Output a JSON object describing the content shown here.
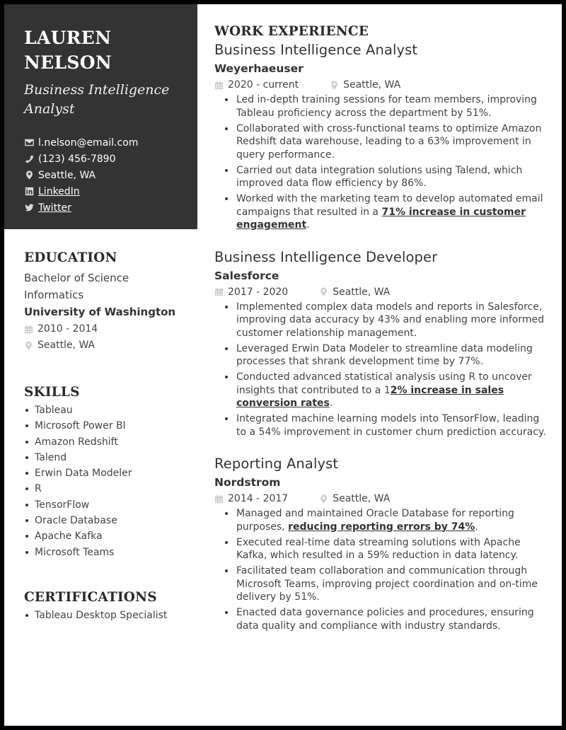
{
  "header": {
    "first_name": "LAUREN",
    "last_name": "NELSON",
    "title": "Business Intelligence Analyst",
    "contacts": {
      "email": "l.nelson@email.com",
      "phone": "(123) 456-7890",
      "location": "Seattle, WA",
      "linkedin": "LinkedIn",
      "twitter": "Twitter"
    }
  },
  "education": {
    "heading": "EDUCATION",
    "degree": "Bachelor of Science",
    "major": "Informatics",
    "school": "University of Washington",
    "dates": "2010 - 2014",
    "location": "Seattle, WA"
  },
  "skills": {
    "heading": "SKILLS",
    "items": [
      "Tableau",
      "Microsoft Power BI",
      "Amazon Redshift",
      "Talend",
      "Erwin Data Modeler",
      "R",
      "TensorFlow",
      "Oracle Database",
      "Apache Kafka",
      "Microsoft Teams"
    ]
  },
  "certifications": {
    "heading": "CERTIFICATIONS",
    "items": [
      "Tableau Desktop Specialist"
    ]
  },
  "work": {
    "heading": "WORK EXPERIENCE",
    "jobs": [
      {
        "title": "Business Intelligence Analyst",
        "company": "Weyerhaeuser",
        "dates": "2020 - current",
        "location": "Seattle, WA",
        "bullets": [
          {
            "pre": "Led in-depth training sessions for team members, improving Tableau proficiency across the department by 51%.",
            "hl": "",
            "post": ""
          },
          {
            "pre": "Collaborated with cross-functional teams to optimize Amazon Redshift data warehouse, leading to a 63% improvement in query performance.",
            "hl": "",
            "post": ""
          },
          {
            "pre": "Carried out data integration solutions using Talend, which improved data flow efficiency by 86%.",
            "hl": "",
            "post": ""
          },
          {
            "pre": "Worked with the marketing team to develop automated email campaigns that resulted in a ",
            "hl": "71% increase in customer engagement",
            "post": "."
          }
        ]
      },
      {
        "title": "Business Intelligence Developer",
        "company": "Salesforce",
        "dates": "2017 - 2020",
        "location": "Seattle, WA",
        "bullets": [
          {
            "pre": "Implemented complex data models and reports in Salesforce, improving data accuracy by 43% and enabling more informed customer relationship management.",
            "hl": "",
            "post": ""
          },
          {
            "pre": "Leveraged Erwin Data Modeler to streamline data modeling processes that shrank development time by 77%.",
            "hl": "",
            "post": ""
          },
          {
            "pre": "Conducted advanced statistical analysis using R to uncover insights that contributed to a 1",
            "hl": "2% increase in sales conversion rates",
            "post": "."
          },
          {
            "pre": "Integrated machine learning models into TensorFlow, leading to a 54% improvement in customer churn prediction accuracy.",
            "hl": "",
            "post": ""
          }
        ]
      },
      {
        "title": "Reporting Analyst",
        "company": "Nordstrom",
        "dates": "2014 - 2017",
        "location": "Seattle, WA",
        "bullets": [
          {
            "pre": "Managed and maintained Oracle Database for reporting purposes, ",
            "hl": "reducing reporting errors by 74%",
            "post": "."
          },
          {
            "pre": "Executed real-time data streaming solutions with Apache Kafka, which resulted in a 59% reduction in data latency.",
            "hl": "",
            "post": ""
          },
          {
            "pre": "Facilitated team collaboration and communication through Microsoft Teams, improving project coordination and on-time delivery by 51%.",
            "hl": "",
            "post": ""
          },
          {
            "pre": "Enacted data governance policies and procedures, ensuring data quality and compliance with industry standards.",
            "hl": "",
            "post": ""
          }
        ]
      }
    ]
  }
}
